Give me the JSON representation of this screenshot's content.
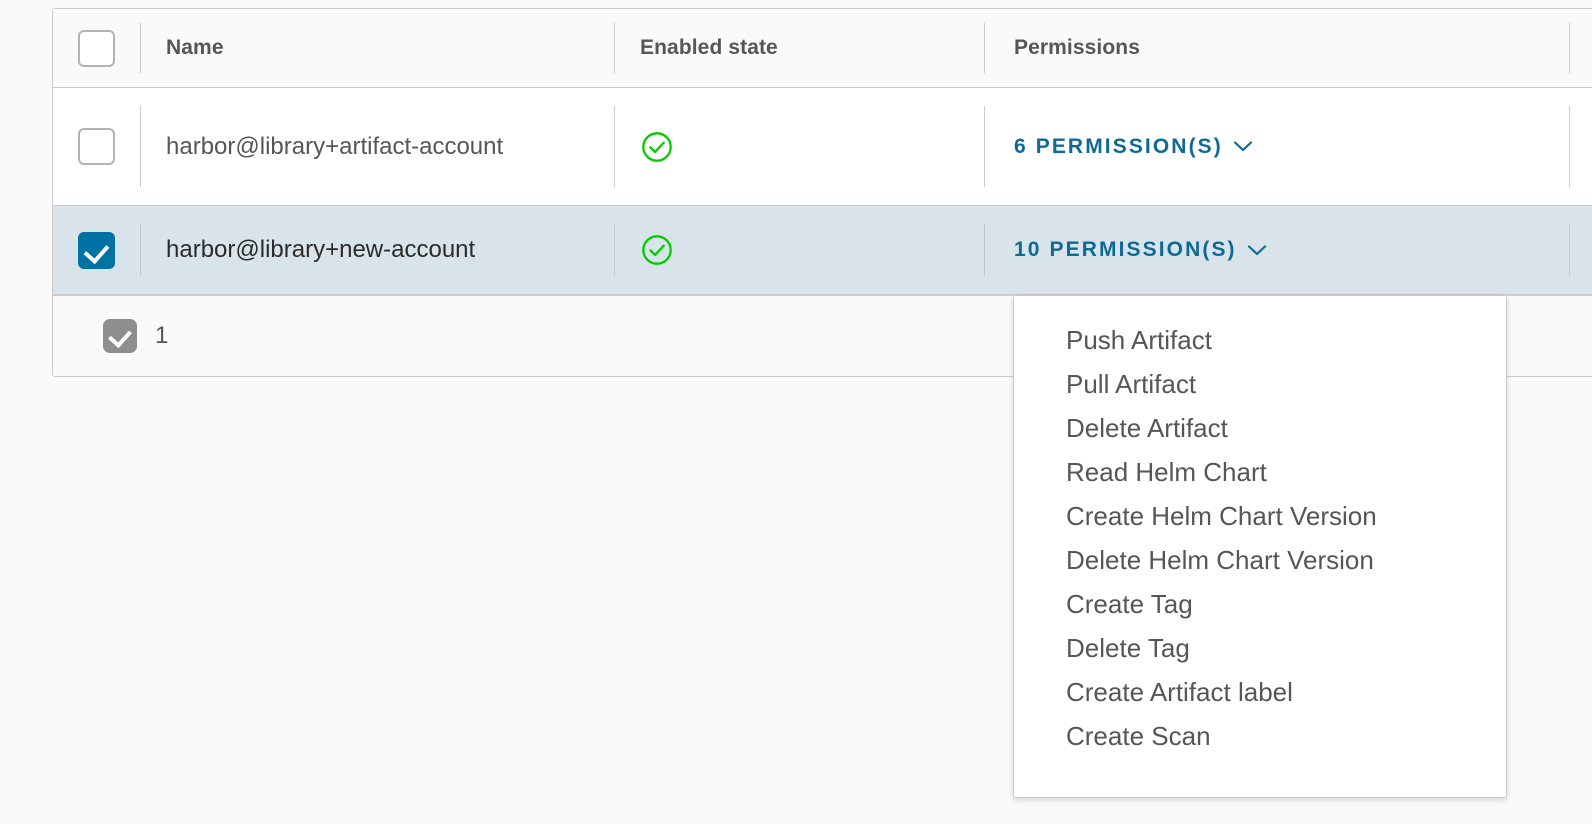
{
  "table": {
    "columns": [
      {
        "key": "select",
        "label": "",
        "icon": "checkbox-icon"
      },
      {
        "key": "name",
        "label": "Name"
      },
      {
        "key": "enabled_state",
        "label": "Enabled state"
      },
      {
        "key": "permissions",
        "label": "Permissions"
      }
    ],
    "rows": [
      {
        "selected": false,
        "name": "harbor@library+artifact-account",
        "enabled_state": "enabled",
        "enabled_icon": "check-circle-icon",
        "permissions_label": "6 PERMISSION(S)",
        "permissions_count": 6,
        "chevron": "chevron-down-icon"
      },
      {
        "selected": true,
        "name": "harbor@library+new-account",
        "enabled_state": "enabled",
        "enabled_icon": "check-circle-icon",
        "permissions_label": "10 PERMISSION(S)",
        "permissions_count": 10,
        "chevron": "chevron-down-icon"
      }
    ],
    "footer": {
      "selected_count": "1",
      "checkbox_state": "checked-disabled"
    }
  },
  "permissions_dropdown": {
    "open": true,
    "source_row": "harbor@library+new-account",
    "items": [
      "Push Artifact",
      "Pull Artifact",
      "Delete Artifact",
      "Read Helm Chart",
      "Create Helm Chart Version",
      "Delete Helm Chart Version",
      "Create Tag",
      "Delete Tag",
      "Create Artifact label",
      "Create Scan"
    ]
  },
  "colors": {
    "link": "#0f6a93",
    "selected_row": "#d9e4ea",
    "checkbox_checked": "#0072a3",
    "status_enabled": "#00cc00",
    "border": "#cccccc",
    "text": "#565656",
    "page_background": "#fafafa"
  }
}
